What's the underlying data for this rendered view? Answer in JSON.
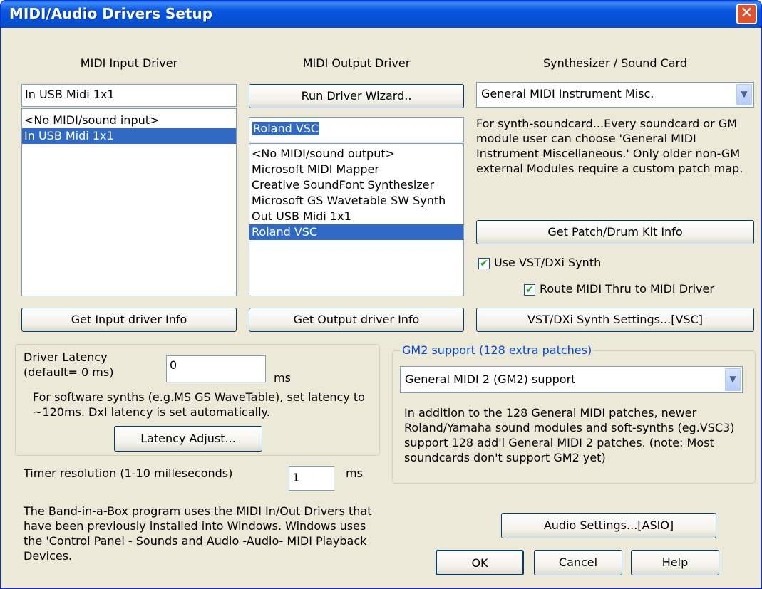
{
  "window": {
    "title": "MIDI/Audio Drivers Setup",
    "close_glyph": "✕"
  },
  "input_column": {
    "header": "MIDI Input Driver",
    "current_value": "In USB Midi 1x1",
    "items": [
      "<No MIDI/sound input>",
      "In USB Midi 1x1"
    ],
    "selected_index": 1,
    "info_button": "Get Input driver Info"
  },
  "output_column": {
    "header": "MIDI Output Driver",
    "wizard_button": "Run Driver Wizard..",
    "current_value": "Roland VSC",
    "items": [
      "<No MIDI/sound output>",
      "Microsoft MIDI Mapper",
      "Creative SoundFont Synthesizer",
      "Microsoft GS Wavetable SW Synth",
      "Out USB Midi 1x1",
      "Roland VSC"
    ],
    "selected_index": 5,
    "info_button": "Get Output driver Info"
  },
  "synth_column": {
    "header": "Synthesizer / Sound Card",
    "selected": "General MIDI Instrument Misc.",
    "help_text": "For synth-soundcard...Every soundcard or GM module user can choose 'General MIDI Instrument Miscellaneous.' Only older non-GM external Modules require a custom patch map.",
    "patch_button": "Get Patch/Drum Kit Info",
    "use_vst_label": "Use VST/DXi Synth",
    "use_vst_checked": true,
    "route_label": "Route MIDI Thru to MIDI Driver",
    "route_checked": true,
    "vst_button": "VST/DXi Synth Settings...[VSC]"
  },
  "latency": {
    "label_line1": "Driver Latency",
    "label_line2": "(default= 0 ms)",
    "value": "0",
    "unit": "ms",
    "note": "For software synths  (e.g.MS GS WaveTable), set latency to ~120ms. DxI latency is set automatically.",
    "adjust_button": "Latency Adjust..."
  },
  "timer": {
    "label": "Timer resolution (1-10 milleseconds)",
    "value": "1",
    "unit": "ms"
  },
  "info_text": "The Band-in-a-Box program uses the MIDI In/Out Drivers that have been previously installed into Windows. Windows uses the 'Control Panel - Sounds and Audio -Audio- MIDI Playback Devices.",
  "gm2": {
    "group_title": "GM2 support (128 extra patches)",
    "selected": "General MIDI 2 (GM2) support",
    "description": "In addition to the 128 General MIDI patches, newer Roland/Yamaha sound modules and soft-synths (eg.VSC3) support 128 add'l General MIDI 2 patches. (note: Most soundcards don't support GM2 yet)"
  },
  "buttons": {
    "audio_settings": "Audio Settings...[ASIO]",
    "ok": "OK",
    "cancel": "Cancel",
    "help": "Help"
  },
  "colors": {
    "titlebar": "#0a5fe8",
    "selection": "#316ac5",
    "dialog_bg": "#ece9d8",
    "group_title": "#0046d5"
  },
  "icons": {
    "dropdown": "chevron-down-icon",
    "check": "checkmark-icon",
    "close": "close-icon"
  }
}
